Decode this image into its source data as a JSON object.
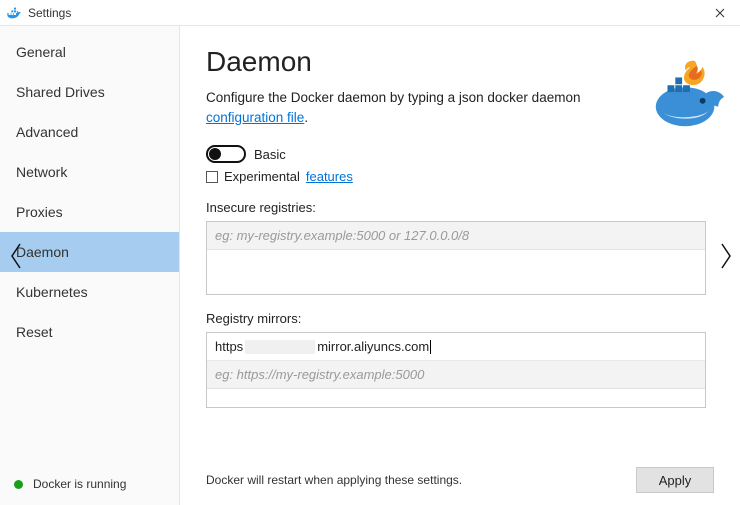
{
  "window": {
    "title": "Settings"
  },
  "sidebar": {
    "items": [
      {
        "label": "General"
      },
      {
        "label": "Shared Drives"
      },
      {
        "label": "Advanced"
      },
      {
        "label": "Network"
      },
      {
        "label": "Proxies"
      },
      {
        "label": "Daemon",
        "selected": true
      },
      {
        "label": "Kubernetes"
      },
      {
        "label": "Reset"
      }
    ],
    "status_text": "Docker is running"
  },
  "main": {
    "heading": "Daemon",
    "description_pre": "Configure the Docker daemon by typing a json docker daemon ",
    "description_link": "configuration file",
    "description_post": ".",
    "basic_toggle": {
      "label": "Basic",
      "on": false
    },
    "experimental": {
      "checked": false,
      "label": "Experimental",
      "link": "features"
    },
    "insecure": {
      "label": "Insecure registries:",
      "placeholder": "eg: my-registry.example:5000 or 127.0.0.0/8",
      "value": ""
    },
    "mirrors": {
      "label": "Registry mirrors:",
      "value_prefix": "https",
      "value_suffix": "mirror.aliyuncs.com",
      "placeholder": "eg: https://my-registry.example:5000"
    },
    "restart_note": "Docker will restart when applying these settings.",
    "apply_label": "Apply"
  },
  "colors": {
    "sidebar_selected": "#a6cdef",
    "link": "#0074d9",
    "status_green": "#1a9e1a"
  }
}
